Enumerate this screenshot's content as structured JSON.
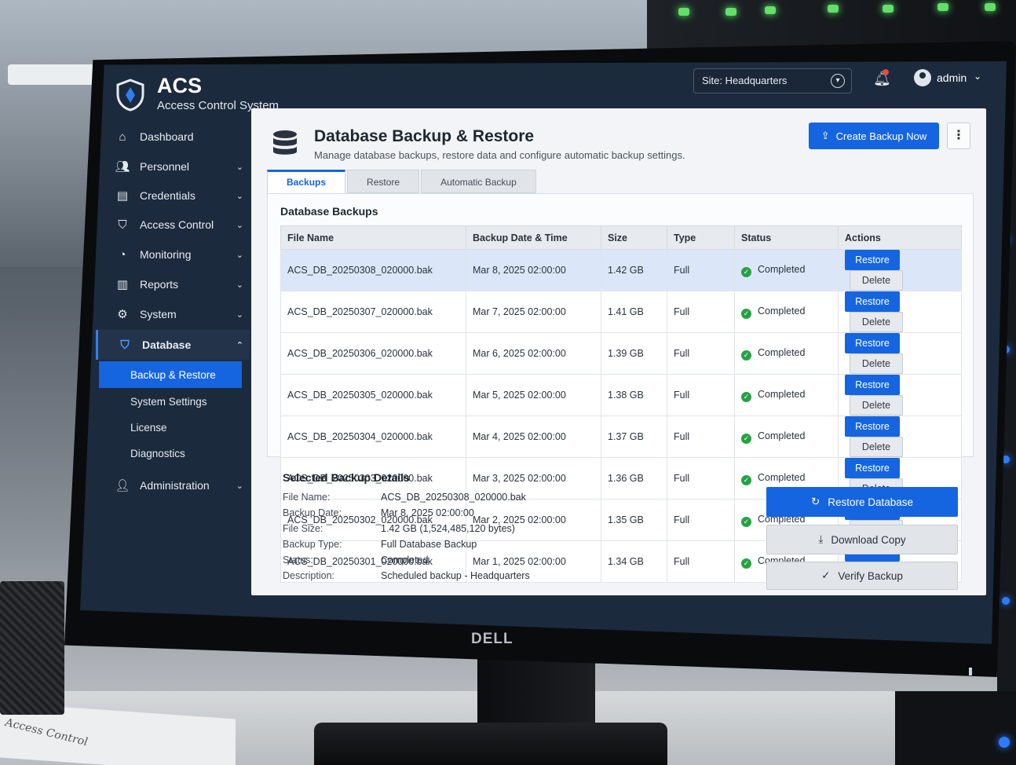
{
  "app": {
    "title": "ACS",
    "subtitle": "Access Control System",
    "brand": "DELL"
  },
  "topbar": {
    "site_label": "Site: Headquarters",
    "user": "admin"
  },
  "sidebar": {
    "items": [
      {
        "label": "Dashboard",
        "icon": "home-icon"
      },
      {
        "label": "Personnel",
        "icon": "people-icon"
      },
      {
        "label": "Credentials",
        "icon": "id-card-icon"
      },
      {
        "label": "Access Control",
        "icon": "shield-icon"
      },
      {
        "label": "Monitoring",
        "icon": "monitor-icon"
      },
      {
        "label": "Reports",
        "icon": "report-icon"
      },
      {
        "label": "System",
        "icon": "gear-icon"
      },
      {
        "label": "Database",
        "icon": "database-icon"
      },
      {
        "label": "Administration",
        "icon": "user-icon"
      }
    ],
    "database_sub": [
      {
        "label": "Backup & Restore"
      },
      {
        "label": "System Settings"
      },
      {
        "label": "License"
      },
      {
        "label": "Diagnostics"
      }
    ]
  },
  "page": {
    "title": "Database Backup & Restore",
    "subtitle": "Manage database backups, restore data and configure automatic backup settings.",
    "create_button": "Create Backup Now",
    "more": "⋮"
  },
  "tabs": [
    {
      "label": "Backups"
    },
    {
      "label": "Restore"
    },
    {
      "label": "Automatic Backup"
    }
  ],
  "backups": {
    "section_title": "Database Backups",
    "columns": [
      "File Name",
      "Backup Date & Time",
      "Size",
      "Type",
      "Status",
      "Actions"
    ],
    "restore_label": "Restore",
    "delete_label": "Delete",
    "rows": [
      {
        "file": "ACS_DB_20250308_020000.bak",
        "date": "Mar 8, 2025 02:00:00",
        "size": "1.42 GB",
        "type": "Full",
        "status": "Completed"
      },
      {
        "file": "ACS_DB_20250307_020000.bak",
        "date": "Mar 7, 2025 02:00:00",
        "size": "1.41 GB",
        "type": "Full",
        "status": "Completed"
      },
      {
        "file": "ACS_DB_20250306_020000.bak",
        "date": "Mar 6, 2025 02:00:00",
        "size": "1.39 GB",
        "type": "Full",
        "status": "Completed"
      },
      {
        "file": "ACS_DB_20250305_020000.bak",
        "date": "Mar 5, 2025 02:00:00",
        "size": "1.38 GB",
        "type": "Full",
        "status": "Completed"
      },
      {
        "file": "ACS_DB_20250304_020000.bak",
        "date": "Mar 4, 2025 02:00:00",
        "size": "1.37 GB",
        "type": "Full",
        "status": "Completed"
      },
      {
        "file": "ACS_DB_20250303_020000.bak",
        "date": "Mar 3, 2025 02:00:00",
        "size": "1.36 GB",
        "type": "Full",
        "status": "Completed"
      },
      {
        "file": "ACS_DB_20250302_020000.bak",
        "date": "Mar 2, 2025 02:00:00",
        "size": "1.35 GB",
        "type": "Full",
        "status": "Completed"
      },
      {
        "file": "ACS_DB_20250301_020000.bak",
        "date": "Mar 1, 2025 02:00:00",
        "size": "1.34 GB",
        "type": "Full",
        "status": "Completed"
      }
    ]
  },
  "details": {
    "title": "Selected Backup Details",
    "fields": [
      {
        "label": "File Name:",
        "value": "ACS_DB_20250308_020000.bak"
      },
      {
        "label": "Backup Date:",
        "value": "Mar 8, 2025 02:00:00"
      },
      {
        "label": "File Size:",
        "value": "1.42 GB (1,524,485,120 bytes)"
      },
      {
        "label": "Backup Type:",
        "value": "Full Database Backup"
      },
      {
        "label": "Status:",
        "value": "Completed"
      },
      {
        "label": "Description:",
        "value": "Scheduled backup - Headquarters"
      }
    ],
    "restore_db": "Restore Database",
    "download": "Download Copy",
    "verify": "Verify Backup"
  },
  "environment": {
    "paper_text": "Access Control"
  },
  "colors": {
    "accent": "#1565e0",
    "sidebar_bg": "#1c2a3d",
    "success": "#25a244"
  }
}
